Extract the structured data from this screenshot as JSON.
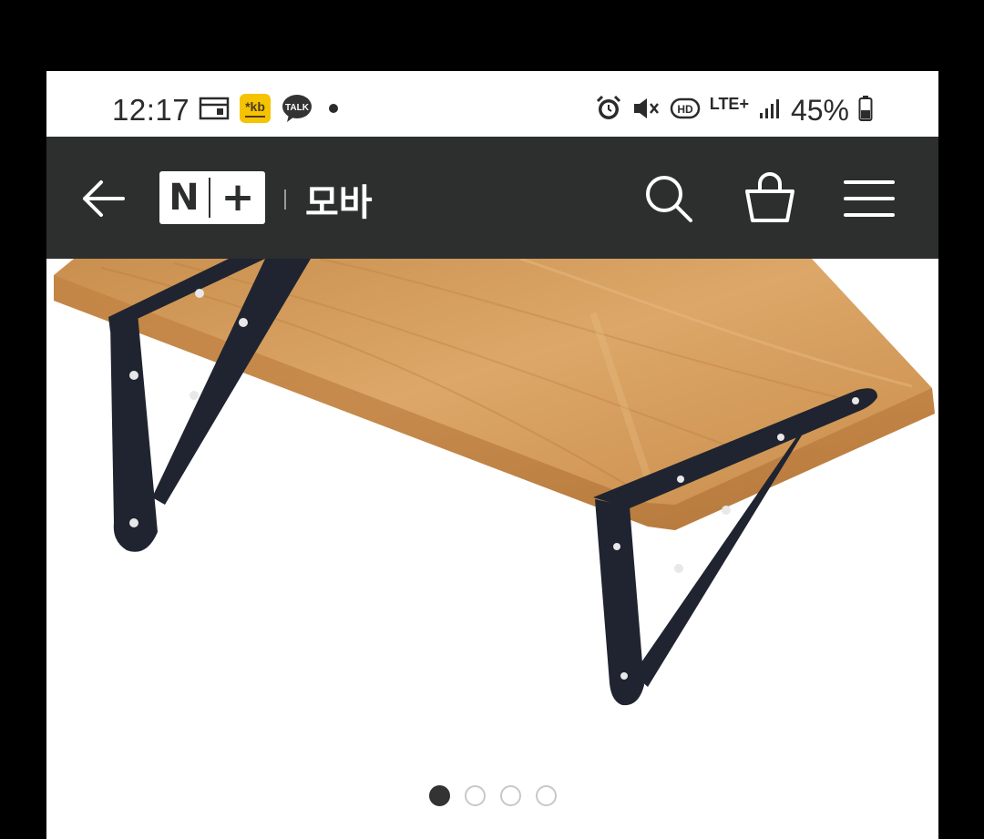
{
  "status_bar": {
    "time": "12:17",
    "notification_icons": [
      "calendar-icon",
      "kb-bank-app-icon",
      "kakaotalk-icon",
      "dot-icon"
    ],
    "system_icons": [
      "alarm-icon",
      "mute-icon",
      "hd-icon",
      "lte-plus-icon",
      "signal-icon",
      "battery-icon"
    ],
    "lte_label": "LTE+",
    "hd_label": "HD",
    "talk_label": "TALK",
    "battery_percent": "45%",
    "battery_level": 0.45
  },
  "header": {
    "logo_letter": "N",
    "logo_plus": "+",
    "title": "모바",
    "icons": [
      "back-arrow-icon",
      "search-icon",
      "shopping-bag-icon",
      "hamburger-menu-icon"
    ],
    "background": "#2d2f2f"
  },
  "product": {
    "image_subject": "wall-shelf-with-black-brackets",
    "carousel": {
      "total": 4,
      "current": 1
    }
  }
}
